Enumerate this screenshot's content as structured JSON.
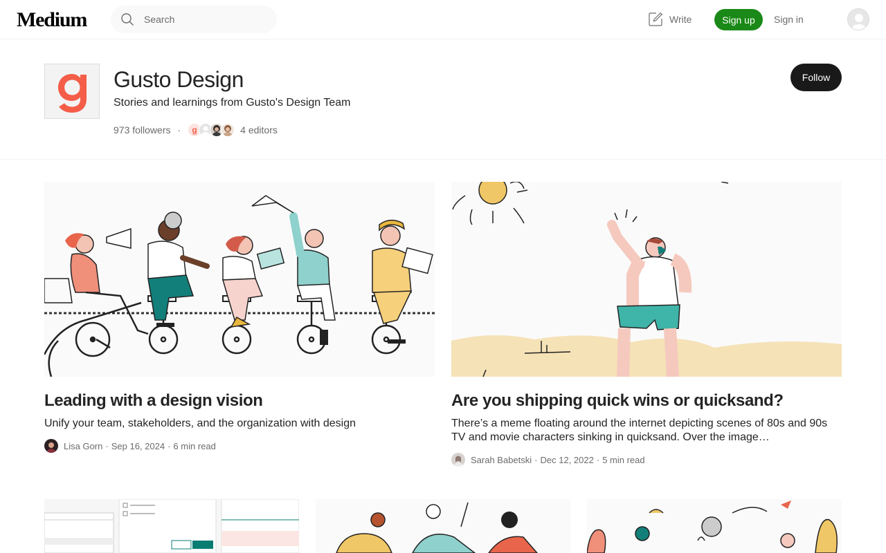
{
  "nav": {
    "logo": "Medium",
    "search_placeholder": "Search",
    "write_label": "Write",
    "signup_label": "Sign up",
    "signin_label": "Sign in"
  },
  "publication": {
    "name": "Gusto Design",
    "tagline": "Stories and learnings from Gusto's Design Team",
    "followers": "973 followers",
    "editors": "4 editors",
    "follow_label": "Follow",
    "brand_color": "#f45d48"
  },
  "stories": [
    {
      "title": "Leading with a design vision",
      "subtitle": "Unify your team, stakeholders, and the organization with design",
      "author": "Lisa Gorn",
      "date": "Sep 16, 2024",
      "read_time": "6 min read"
    },
    {
      "title": "Are you shipping quick wins or quicksand?",
      "subtitle": "There’s a meme floating around the internet depicting scenes of 80s and 90s TV and movie characters sinking in quicksand. Over the image…",
      "author": "Sarah Babetski",
      "date": "Dec 12, 2022",
      "read_time": "5 min read"
    }
  ],
  "colors": {
    "accent_green": "#1a8917",
    "follow_button": "#191919",
    "text": "#242424",
    "muted": "#6b6b6b"
  }
}
